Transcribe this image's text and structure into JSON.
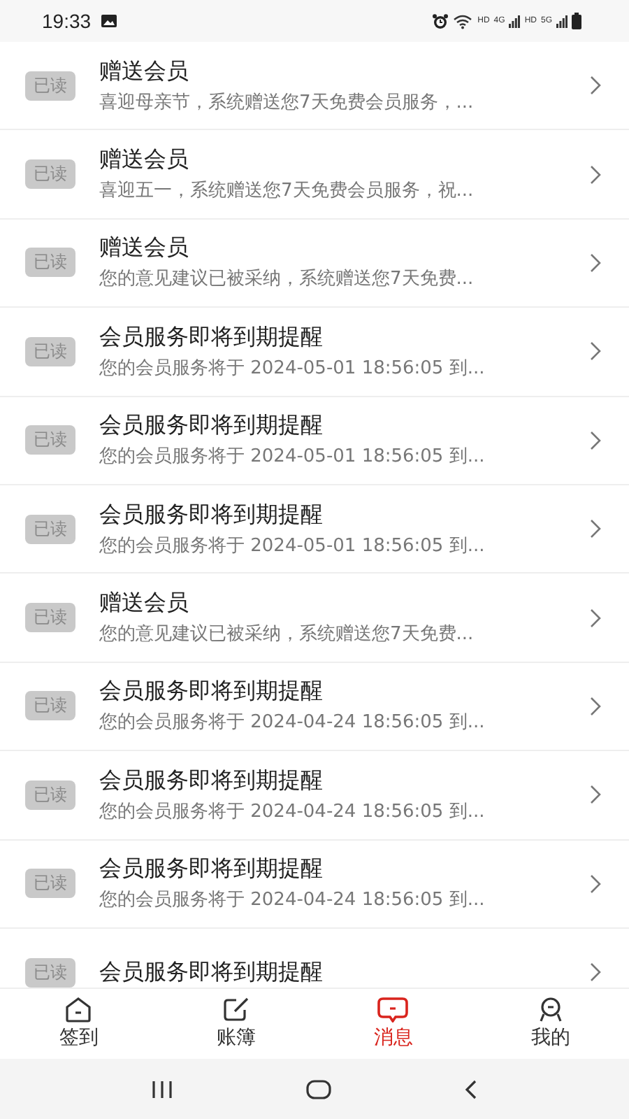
{
  "status_bar": {
    "time": "19:33",
    "network_labels": [
      "HD",
      "4G",
      "HD",
      "5G"
    ]
  },
  "messages": [
    {
      "badge": "已读",
      "read": true,
      "title": "赠送会员",
      "preview": "喜迎母亲节，系统赠送您7天免费会员服务，..."
    },
    {
      "badge": "已读",
      "read": true,
      "title": "赠送会员",
      "preview": "喜迎五一，系统赠送您7天免费会员服务，祝..."
    },
    {
      "badge": "已读",
      "read": true,
      "title": "赠送会员",
      "preview": "您的意见建议已被采纳，系统赠送您7天免费..."
    },
    {
      "badge": "已读",
      "read": true,
      "title": "会员服务即将到期提醒",
      "preview": "您的会员服务将于 2024-05-01 18:56:05 到..."
    },
    {
      "badge": "已读",
      "read": true,
      "title": "会员服务即将到期提醒",
      "preview": "您的会员服务将于 2024-05-01 18:56:05 到..."
    },
    {
      "badge": "已读",
      "read": true,
      "title": "会员服务即将到期提醒",
      "preview": "您的会员服务将于 2024-05-01 18:56:05 到..."
    },
    {
      "badge": "已读",
      "read": true,
      "title": "赠送会员",
      "preview": "您的意见建议已被采纳，系统赠送您7天免费..."
    },
    {
      "badge": "已读",
      "read": true,
      "title": "会员服务即将到期提醒",
      "preview": "您的会员服务将于 2024-04-24 18:56:05 到..."
    },
    {
      "badge": "已读",
      "read": true,
      "title": "会员服务即将到期提醒",
      "preview": "您的会员服务将于 2024-04-24 18:56:05 到..."
    },
    {
      "badge": "已读",
      "read": true,
      "title": "会员服务即将到期提醒",
      "preview": "您的会员服务将于 2024-04-24 18:56:05 到..."
    },
    {
      "badge": "已读",
      "read": true,
      "title": "会员服务即将到期提醒"
    }
  ],
  "tabs": [
    {
      "label": "签到",
      "kind": "home",
      "selected": false
    },
    {
      "label": "账簿",
      "kind": "edit",
      "selected": false
    },
    {
      "label": "消息",
      "kind": "message",
      "selected": true
    },
    {
      "label": "我的",
      "kind": "person",
      "selected": false
    }
  ]
}
